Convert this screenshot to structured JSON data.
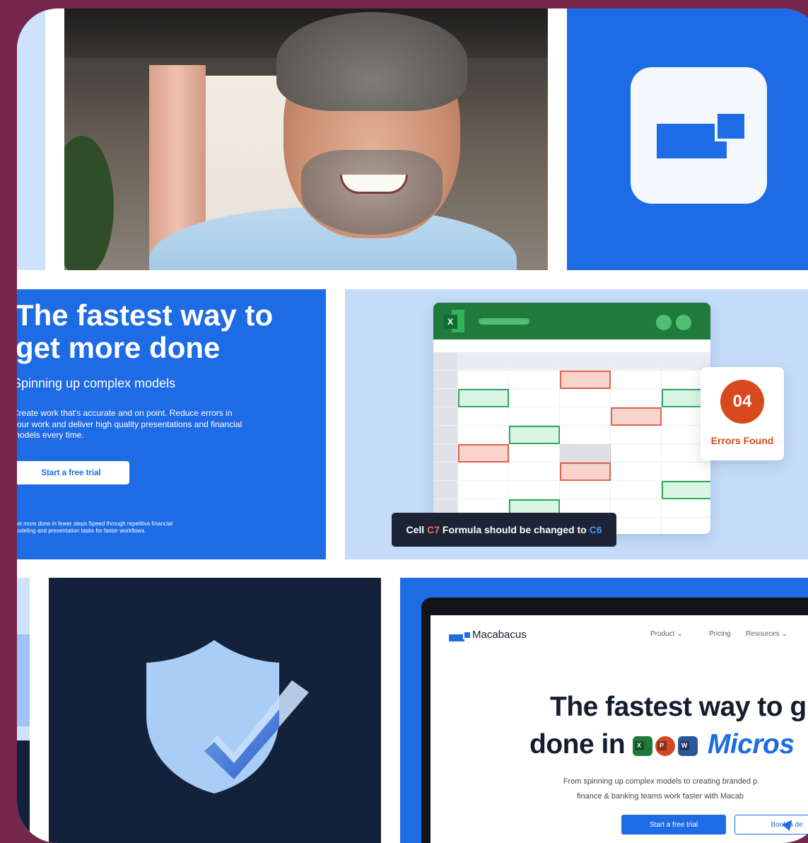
{
  "hero": {
    "title": "The fastest way to get more done",
    "subtitle": "Spinning up complex models",
    "body": "Create work that's accurate and on point. Reduce errors in your work and deliver high quality presentations and financial models every time.",
    "cta_label": "Start a free trial",
    "footer": "Get more done in fewer steps Speed through repetitive financial modeling and presentation tasks for faster workflows."
  },
  "spreadsheet": {
    "app_letter": "X",
    "error_count": "04",
    "error_label": "Errors Found",
    "tooltip": {
      "prefix": "Cell",
      "cell": "C7",
      "middle": "Formula should be changed to",
      "target": "C6"
    }
  },
  "website": {
    "brand": "Macabacus",
    "nav": [
      "Product ⌄",
      "Pricing",
      "Resources ⌄"
    ],
    "title_line1": "The fastest way to g",
    "title_line2_prefix": "done in",
    "title_line2_brand": "Micros",
    "app_icons": [
      "X",
      "P",
      "W"
    ],
    "description_line1": "From spinning up complex models to creating branded p",
    "description_line2": "finance & banking teams work faster with Macab",
    "primary_button": "Start a free trial",
    "secondary_button": "Book a de"
  },
  "colors": {
    "background": "#75264c",
    "brand_blue": "#1e6be6",
    "navy": "#13213b",
    "error": "#d84a1e",
    "excel_green": "#1f7a3c"
  },
  "icons": [
    "macabacus-logo-icon",
    "shield-check-icon",
    "excel-icon",
    "powerpoint-icon",
    "word-icon"
  ]
}
